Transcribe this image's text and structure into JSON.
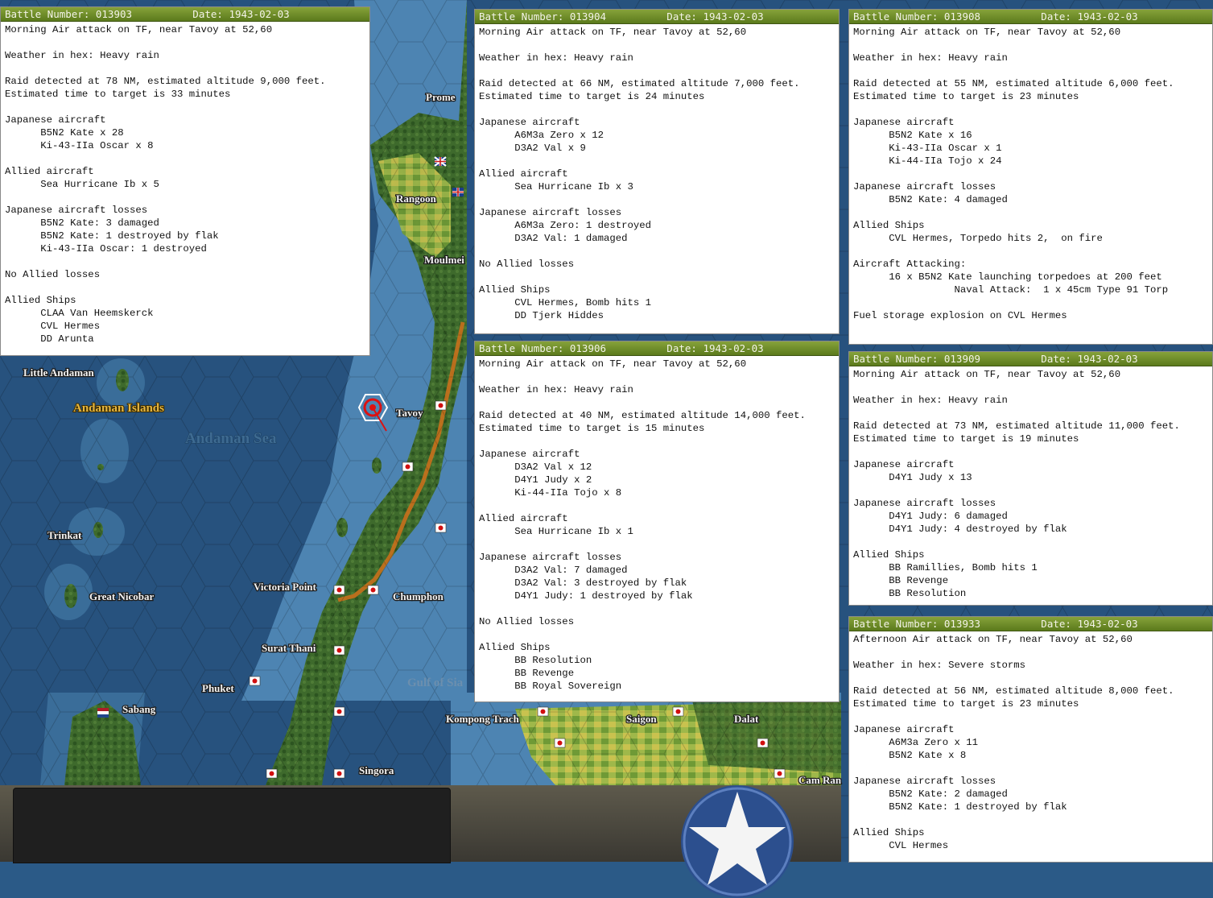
{
  "map": {
    "labels": {
      "little_andaman": "Little Andaman",
      "andaman_islands": "Andaman Islands",
      "andaman_sea": "Andaman Sea",
      "trinkat": "Trinkat",
      "great_nicobar": "Great Nicobar",
      "prome": "Prome",
      "rangoon": "Rangoon",
      "moulmein": "Moulmei",
      "tavoy": "Tavoy",
      "victoria_point": "Victoria Point",
      "chumphon": "Chumphon",
      "surat_thani": "Surat Thani",
      "phuket": "Phuket",
      "gulf_of_siam": "Gulf of Sia",
      "sabang": "Sabang",
      "singora": "Singora",
      "kompong_trach": "Kompong Trach",
      "saigon": "Saigon",
      "dalat": "Dalat",
      "cam_ranh": "Cam Ran"
    },
    "colors": {
      "sea_deep": "#24507c",
      "sea_shallow": "#4f86b4",
      "land": "#3d6b2e",
      "route": "#c8701c",
      "japan_flag": "#d10f0f"
    }
  },
  "reports": [
    {
      "header": "Battle Number: 013903          Date: 1943-02-03",
      "lines": [
        "Morning Air attack on TF, near Tavoy at 52,60",
        "",
        "Weather in hex: Heavy rain",
        "",
        "Raid detected at 78 NM, estimated altitude 9,000 feet.",
        "Estimated time to target is 33 minutes",
        "",
        "Japanese aircraft",
        "      B5N2 Kate x 28",
        "      Ki-43-IIa Oscar x 8",
        "",
        "Allied aircraft",
        "      Sea Hurricane Ib x 5",
        "",
        "Japanese aircraft losses",
        "      B5N2 Kate: 3 damaged",
        "      B5N2 Kate: 1 destroyed by flak",
        "      Ki-43-IIa Oscar: 1 destroyed",
        "",
        "No Allied losses",
        "",
        "Allied Ships",
        "      CLAA Van Heemskerck",
        "      CVL Hermes",
        "      DD Arunta"
      ]
    },
    {
      "header": "Battle Number: 013904          Date: 1943-02-03",
      "lines": [
        "Morning Air attack on TF, near Tavoy at 52,60",
        "",
        "Weather in hex: Heavy rain",
        "",
        "Raid detected at 66 NM, estimated altitude 7,000 feet.",
        "Estimated time to target is 24 minutes",
        "",
        "Japanese aircraft",
        "      A6M3a Zero x 12",
        "      D3A2 Val x 9",
        "",
        "Allied aircraft",
        "      Sea Hurricane Ib x 3",
        "",
        "Japanese aircraft losses",
        "      A6M3a Zero: 1 destroyed",
        "      D3A2 Val: 1 damaged",
        "",
        "No Allied losses",
        "",
        "Allied Ships",
        "      CVL Hermes, Bomb hits 1",
        "      DD Tjerk Hiddes"
      ]
    },
    {
      "header": "Battle Number: 013906          Date: 1943-02-03",
      "lines": [
        "Morning Air attack on TF, near Tavoy at 52,60",
        "",
        "Weather in hex: Heavy rain",
        "",
        "Raid detected at 40 NM, estimated altitude 14,000 feet.",
        "Estimated time to target is 15 minutes",
        "",
        "Japanese aircraft",
        "      D3A2 Val x 12",
        "      D4Y1 Judy x 2",
        "      Ki-44-IIa Tojo x 8",
        "",
        "Allied aircraft",
        "      Sea Hurricane Ib x 1",
        "",
        "Japanese aircraft losses",
        "      D3A2 Val: 7 damaged",
        "      D3A2 Val: 3 destroyed by flak",
        "      D4Y1 Judy: 1 destroyed by flak",
        "",
        "No Allied losses",
        "",
        "Allied Ships",
        "      BB Resolution",
        "      BB Revenge",
        "      BB Royal Sovereign"
      ]
    },
    {
      "header": "Battle Number: 013908          Date: 1943-02-03",
      "lines": [
        "Morning Air attack on TF, near Tavoy at 52,60",
        "",
        "Weather in hex: Heavy rain",
        "",
        "Raid detected at 55 NM, estimated altitude 6,000 feet.",
        "Estimated time to target is 23 minutes",
        "",
        "Japanese aircraft",
        "      B5N2 Kate x 16",
        "      Ki-43-IIa Oscar x 1",
        "      Ki-44-IIa Tojo x 24",
        "",
        "Japanese aircraft losses",
        "      B5N2 Kate: 4 damaged",
        "",
        "Allied Ships",
        "      CVL Hermes, Torpedo hits 2,  on fire",
        "",
        "Aircraft Attacking:",
        "      16 x B5N2 Kate launching torpedoes at 200 feet",
        "                 Naval Attack:  1 x 45cm Type 91 Torp",
        "",
        "Fuel storage explosion on CVL Hermes"
      ]
    },
    {
      "header": "Battle Number: 013909          Date: 1943-02-03",
      "lines": [
        "Morning Air attack on TF, near Tavoy at 52,60",
        "",
        "Weather in hex: Heavy rain",
        "",
        "Raid detected at 73 NM, estimated altitude 11,000 feet.",
        "Estimated time to target is 19 minutes",
        "",
        "Japanese aircraft",
        "      D4Y1 Judy x 13",
        "",
        "Japanese aircraft losses",
        "      D4Y1 Judy: 6 damaged",
        "      D4Y1 Judy: 4 destroyed by flak",
        "",
        "Allied Ships",
        "      BB Ramillies, Bomb hits 1",
        "      BB Revenge",
        "      BB Resolution"
      ]
    },
    {
      "header": "Battle Number: 013933          Date: 1943-02-03",
      "lines": [
        "Afternoon Air attack on TF, near Tavoy at 52,60",
        "",
        "Weather in hex: Severe storms",
        "",
        "Raid detected at 56 NM, estimated altitude 8,000 feet.",
        "Estimated time to target is 23 minutes",
        "",
        "Japanese aircraft",
        "      A6M3a Zero x 11",
        "      B5N2 Kate x 8",
        "",
        "Japanese aircraft losses",
        "      B5N2 Kate: 2 damaged",
        "      B5N2 Kate: 1 destroyed by flak",
        "",
        "Allied Ships",
        "      CVL Hermes"
      ]
    }
  ]
}
